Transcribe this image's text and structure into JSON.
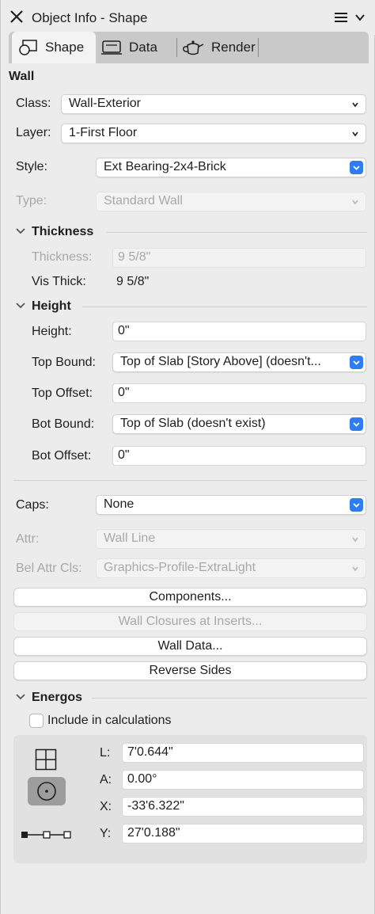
{
  "window": {
    "title": "Object Info - Shape"
  },
  "tabs": [
    {
      "label": "Shape",
      "icon": "shape-icon",
      "active": true
    },
    {
      "label": "Data",
      "icon": "data-icon",
      "active": false
    },
    {
      "label": "Render",
      "icon": "teapot-icon",
      "active": false
    }
  ],
  "object_type": "Wall",
  "fields": {
    "class": {
      "label": "Class:",
      "value": "Wall-Exterior"
    },
    "layer": {
      "label": "Layer:",
      "value": "1-First Floor"
    },
    "style": {
      "label": "Style:",
      "value": "Ext Bearing-2x4-Brick"
    },
    "type": {
      "label": "Type:",
      "value": "Standard Wall",
      "disabled": true
    }
  },
  "thickness_section": {
    "title": "Thickness",
    "thickness": {
      "label": "Thickness:",
      "value": "9 5/8\"",
      "disabled": true
    },
    "vis_thick": {
      "label": "Vis Thick:",
      "value": "9 5/8\""
    }
  },
  "height_section": {
    "title": "Height",
    "height": {
      "label": "Height:",
      "value": "0\""
    },
    "top_bound": {
      "label": "Top Bound:",
      "value": "Top of Slab [Story Above] (doesn't..."
    },
    "top_offset": {
      "label": "Top Offset:",
      "value": "0\""
    },
    "bot_bound": {
      "label": "Bot Bound:",
      "value": "Top of Slab (doesn't exist)"
    },
    "bot_offset": {
      "label": "Bot Offset:",
      "value": "0\""
    }
  },
  "caps": {
    "label": "Caps:",
    "value": "None"
  },
  "attr": {
    "label": "Attr:",
    "value": "Wall Line",
    "disabled": true
  },
  "bel_attr": {
    "label": "Bel Attr Cls:",
    "value": "Graphics-Profile-ExtraLight",
    "disabled": true
  },
  "buttons": {
    "components": "Components...",
    "wall_closures": "Wall Closures at Inserts...",
    "wall_data": "Wall Data...",
    "reverse_sides": "Reverse Sides"
  },
  "energos": {
    "title": "Energos",
    "include_label": "Include in calculations",
    "include_checked": false
  },
  "coords": {
    "l": {
      "label": "L:",
      "value": "7'0.644\""
    },
    "a": {
      "label": "A:",
      "value": "0.00°"
    },
    "x": {
      "label": "X:",
      "value": "-33'6.322\""
    },
    "y": {
      "label": "Y:",
      "value": "27'0.188\""
    }
  },
  "colors": {
    "accent": "#2e7cf6",
    "panel_bg": "#ececec",
    "disabled_text": "#a8a8a8"
  }
}
